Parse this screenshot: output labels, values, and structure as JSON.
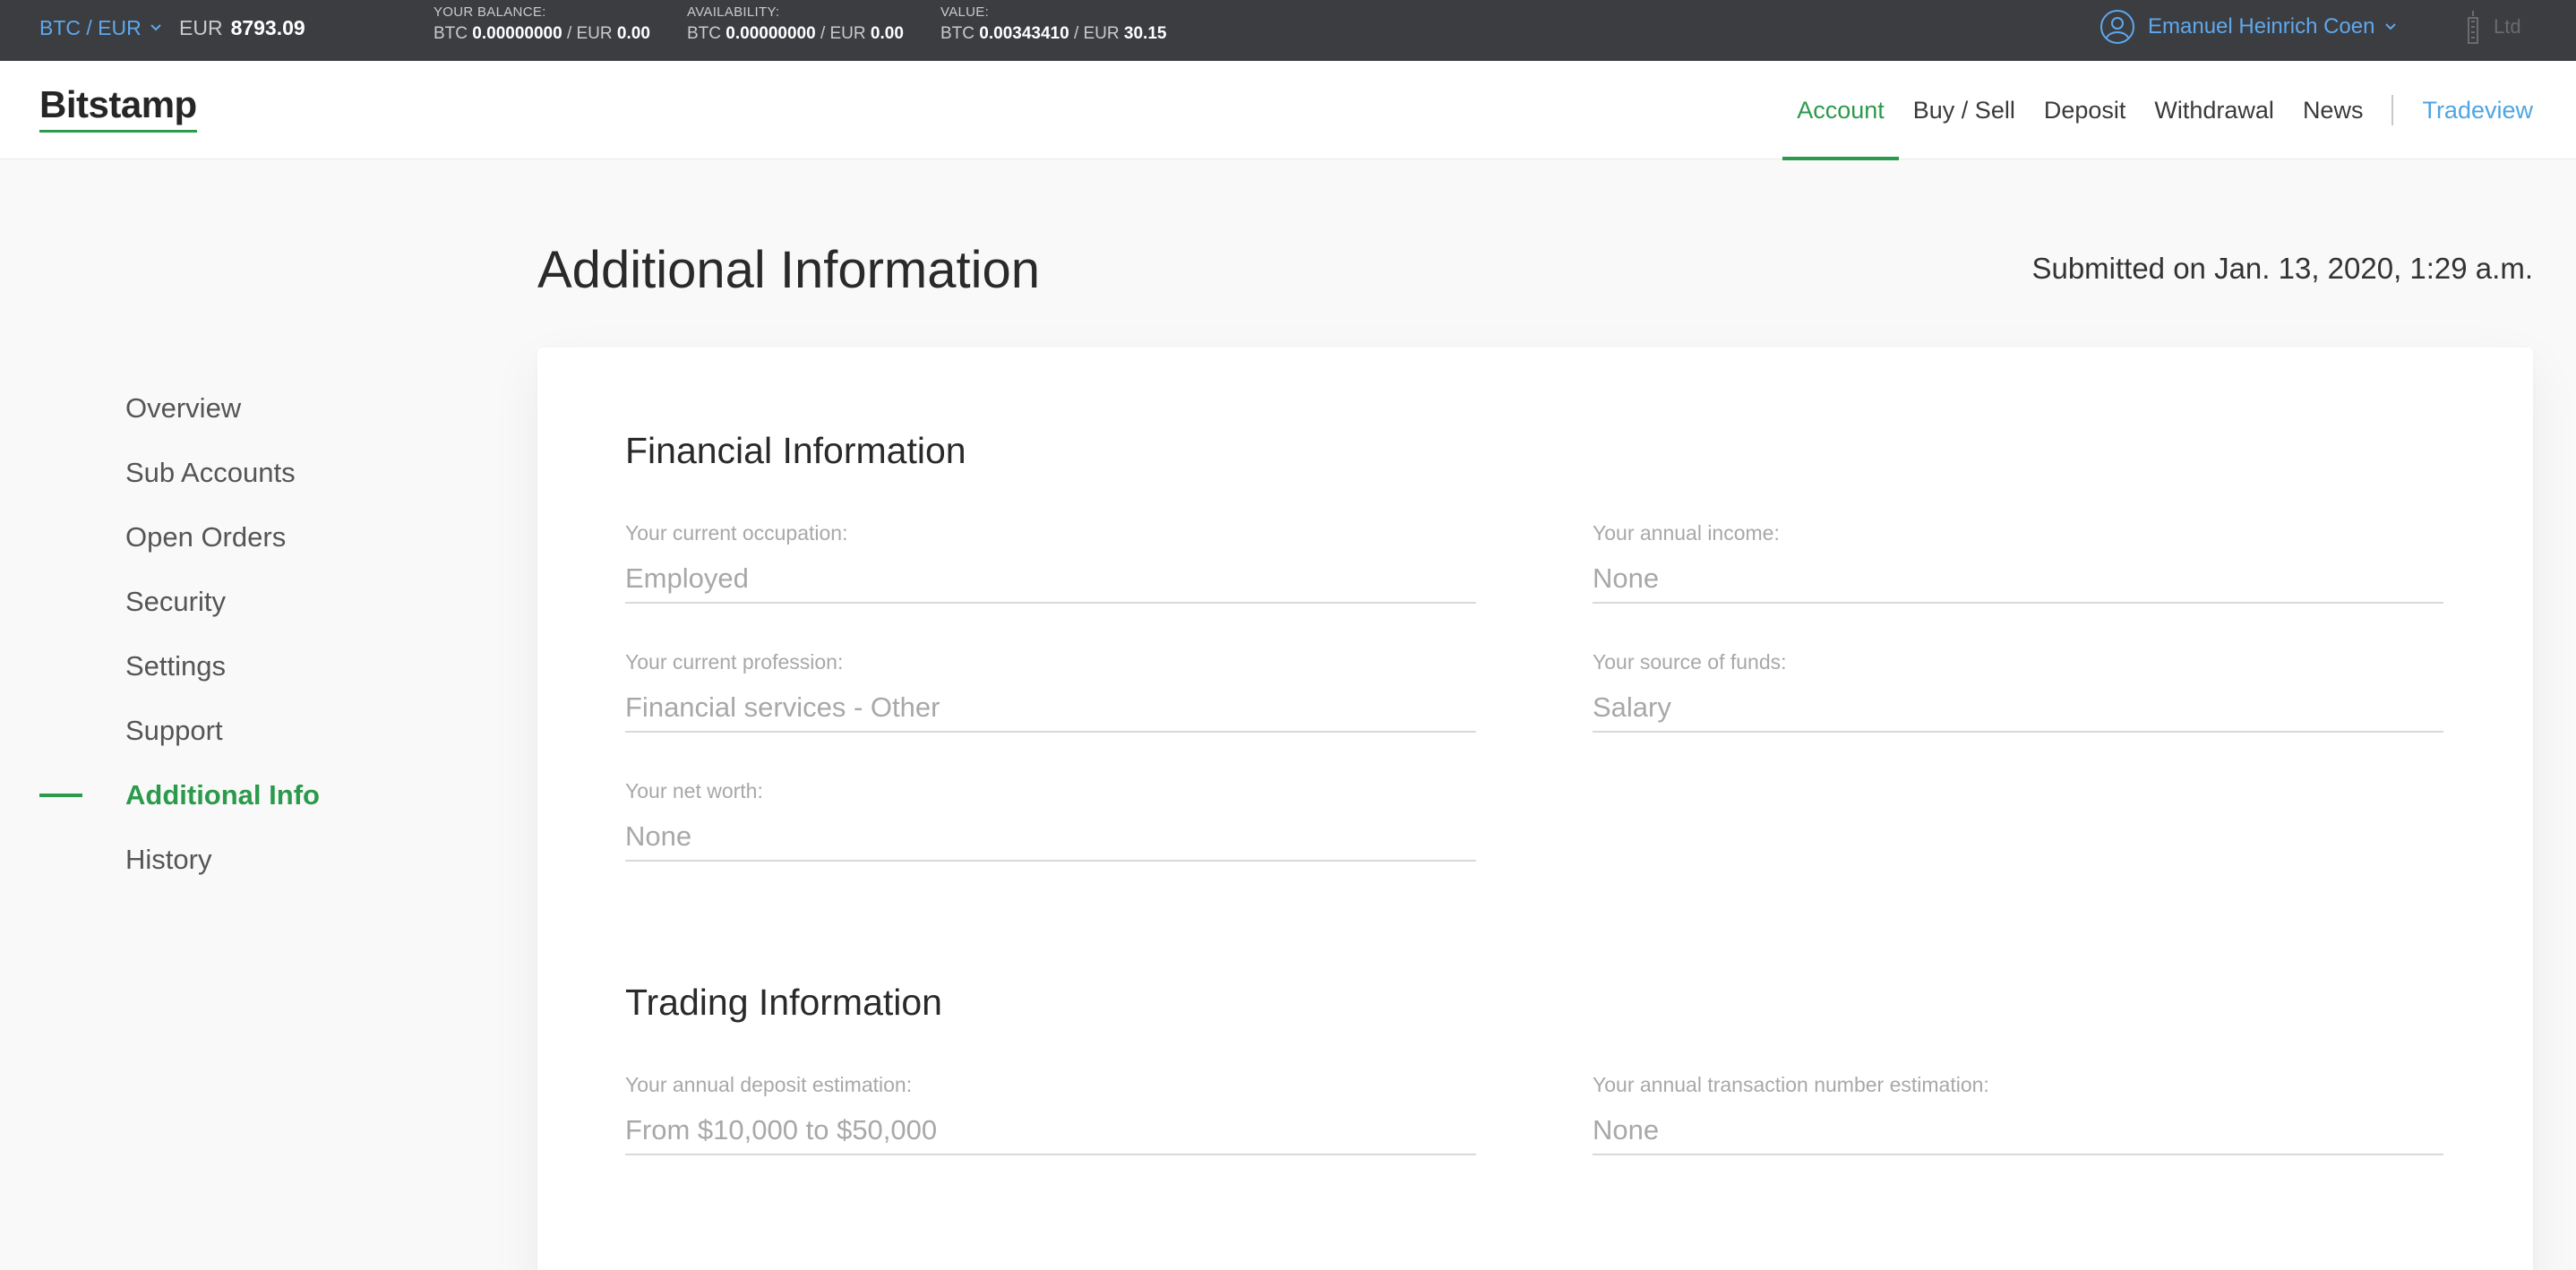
{
  "ticker": {
    "pair": "BTC / EUR",
    "price_currency": "EUR",
    "price_value": "8793.09",
    "balance": {
      "label": "YOUR BALANCE:",
      "btc_label": "BTC",
      "btc": "0.00000000",
      "eur_label": "/ EUR",
      "eur": "0.00"
    },
    "availability": {
      "label": "AVAILABILITY:",
      "btc_label": "BTC",
      "btc": "0.00000000",
      "eur_label": "/ EUR",
      "eur": "0.00"
    },
    "value": {
      "label": "VALUE:",
      "btc_label": "BTC",
      "btc": "0.00343410",
      "eur_label": "/ EUR",
      "eur": "30.15"
    },
    "user_name": "Emanuel Heinrich Coen",
    "entity": "Ltd"
  },
  "header": {
    "logo": "Bitstamp",
    "nav": {
      "account": "Account",
      "buy_sell": "Buy / Sell",
      "deposit": "Deposit",
      "withdrawal": "Withdrawal",
      "news": "News",
      "tradeview": "Tradeview"
    }
  },
  "sidebar": {
    "items": [
      "Overview",
      "Sub Accounts",
      "Open Orders",
      "Security",
      "Settings",
      "Support",
      "Additional Info",
      "History"
    ],
    "active": "Additional Info"
  },
  "main": {
    "title": "Additional Information",
    "submitted": "Submitted on Jan. 13, 2020, 1:29 a.m.",
    "financial": {
      "title": "Financial Information",
      "occupation": {
        "label": "Your current occupation:",
        "value": "Employed"
      },
      "income": {
        "label": "Your annual income:",
        "value": "None"
      },
      "profession": {
        "label": "Your current profession:",
        "value": "Financial services - Other"
      },
      "funds": {
        "label": "Your source of funds:",
        "value": "Salary"
      },
      "net_worth": {
        "label": "Your net worth:",
        "value": "None"
      }
    },
    "trading": {
      "title": "Trading Information",
      "deposit": {
        "label": "Your annual deposit estimation:",
        "value": "From $10,000 to $50,000"
      },
      "transactions": {
        "label": "Your annual transaction number estimation:",
        "value": "None"
      }
    }
  },
  "colors": {
    "accent_green": "#2c9a4c",
    "link_blue": "#5ea8ec",
    "ticker_bg": "#3c3d41"
  }
}
